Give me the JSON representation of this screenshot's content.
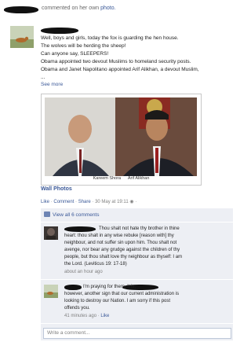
{
  "header": {
    "action_text": "commented on her own",
    "photo_link": "photo."
  },
  "post": {
    "lines": [
      "Well, boys and girls, today the fox is guarding the hen house.",
      "The wolves will be herding the sheep!",
      "Can anyone say, SLEEPERS!",
      "Obama appointed two devout Muslims to homeland security posts.",
      "Obama and Janet Napolitano appointed Arif Alikhan, a devout Muslim,",
      "..."
    ],
    "see_more": "See more"
  },
  "photo": {
    "caption_left": "Kareem Shora",
    "caption_right": "Arif Alikhan",
    "album_link": "Wall Photos"
  },
  "actions": {
    "like": "Like",
    "comment": "Comment",
    "share": "Share",
    "timestamp": "30 May at 19:11",
    "separator": "·"
  },
  "comments_section": {
    "view_all": "View all 6 comments",
    "comments": [
      {
        "text_lines": [
          "Thou shalt not hate thy brother in thine",
          "heart: thou shalt in any wise rebuke [reason with] thy",
          "neighbour, and not suffer sin upon him. Thou shalt not",
          "avenge, nor bear any grudge against the children of thy",
          "people, but thou shalt love thy neighbour as thyself: I am",
          "the Lord. (Leviticus 19: 17-18)"
        ],
        "meta": "about an hour ago",
        "like": "Like"
      },
      {
        "text_lines": [
          "I'm praying for them.                It is,",
          "however, another sign that our current administration is",
          "looking to destroy our Nation. I am sorry if this post",
          "offends you."
        ],
        "meta": "41 minutes ago",
        "like": "Like"
      }
    ],
    "write_placeholder": "Write a comment..."
  }
}
